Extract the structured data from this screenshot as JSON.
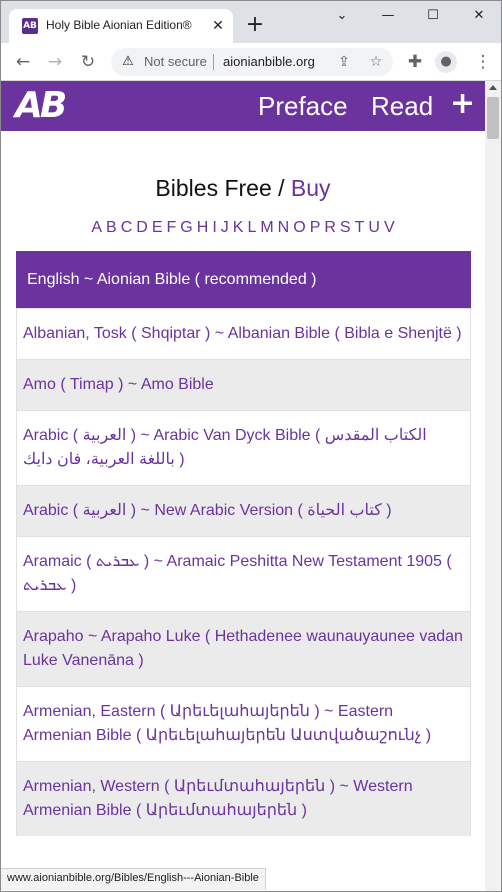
{
  "browser": {
    "tab_title": "Holy Bible Aionian Edition®",
    "tab_favicon": "AB",
    "security_label": "Not secure",
    "url": "aionianbible.org",
    "icons": {
      "back": "arrow-left-icon",
      "forward": "arrow-right-icon",
      "reload": "reload-icon",
      "warning": "warning-icon",
      "share": "share-icon",
      "bookmark": "star-icon",
      "extensions": "puzzle-icon",
      "profile": "profile-icon",
      "menu": "kebab-menu-icon"
    }
  },
  "header": {
    "logo": "AB",
    "nav": {
      "preface": "Preface",
      "read": "Read",
      "plus": "+"
    }
  },
  "headline": {
    "main": "Bibles Free / ",
    "buy": "Buy"
  },
  "letters": [
    "A",
    "B",
    "C",
    "D",
    "E",
    "F",
    "G",
    "H",
    "I",
    "J",
    "K",
    "L",
    "M",
    "N",
    "O",
    "P",
    "R",
    "S",
    "T",
    "U",
    "V"
  ],
  "bibles": [
    {
      "text": "English ~ Aionian Bible ( recommended )",
      "style": "featured"
    },
    {
      "text": "Albanian, Tosk ( Shqiptar ) ~ Albanian Bible ( Bibla e Shenjtë )",
      "style": "plain"
    },
    {
      "text": "Amo ( Timap ) ~ Amo Bible",
      "style": "alt"
    },
    {
      "text": "Arabic ( العربية ) ~ Arabic Van Dyck Bible ( الكتاب المقدس باللغة العربية، فان دايك )",
      "style": "plain"
    },
    {
      "text": "Arabic ( العربية ) ~ New Arabic Version ( كتاب الحياة )",
      "style": "alt"
    },
    {
      "text": "Aramaic ( ܥܒܪܝܬ ) ~ Aramaic Peshitta New Testament 1905 ( ܥܒܪܝܬ )",
      "style": "plain"
    },
    {
      "text": "Arapaho ~ Arapaho Luke ( Hethadenee waunauyaunee vadan Luke Vanenāna )",
      "style": "alt"
    },
    {
      "text": "Armenian, Eastern ( Արեւելահայերեն ) ~ Eastern Armenian Bible ( Արեւելահայերեն Աստվածաշունչ )",
      "style": "plain"
    },
    {
      "text": "Armenian, Western ( Արեւմտահայերեն ) ~ Western Armenian Bible ( Արեւմտահայերեն )",
      "style": "alt"
    }
  ],
  "status_bar": "www.aionianbible.org/Bibles/English---Aionian-Bible"
}
